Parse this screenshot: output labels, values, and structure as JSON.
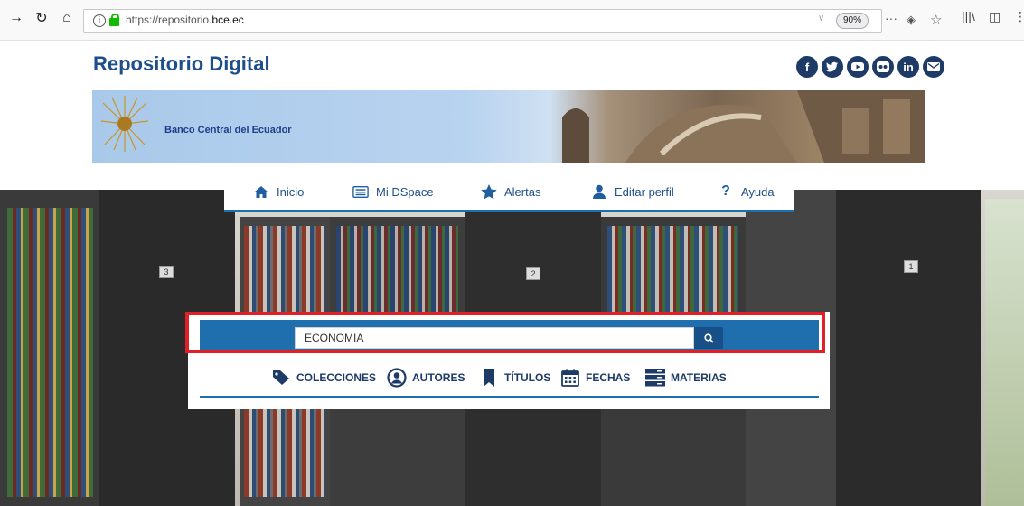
{
  "browser": {
    "url_prefix": "https://repositorio.",
    "url_domain": "bce.ec",
    "zoom": "90%"
  },
  "header": {
    "site_title": "Repositorio Digital",
    "banner_text": "Banco Central del Ecuador",
    "social": [
      "f",
      "t",
      "yt",
      "fk",
      "in",
      "mail"
    ]
  },
  "menu": {
    "items": [
      {
        "label": "Inicio",
        "icon": "home-icon"
      },
      {
        "label": "Mi DSpace",
        "icon": "list-icon"
      },
      {
        "label": "Alertas",
        "icon": "star-icon"
      },
      {
        "label": "Editar perfil",
        "icon": "user-icon"
      },
      {
        "label": "Ayuda",
        "icon": "question-icon"
      }
    ]
  },
  "search": {
    "value": "ECONOMIA"
  },
  "browse": {
    "items": [
      {
        "label": "COLECCIONES",
        "icon": "tag-icon"
      },
      {
        "label": "AUTORES",
        "icon": "user-circle-icon"
      },
      {
        "label": "TÍTULOS",
        "icon": "bookmark-icon"
      },
      {
        "label": "FECHAS",
        "icon": "calendar-icon"
      },
      {
        "label": "MATERIAS",
        "icon": "server-icon"
      }
    ]
  },
  "shelves": {
    "numbers": [
      "3",
      "2",
      "1"
    ]
  },
  "colors": {
    "accent": "#1f6fae",
    "title": "#1e4f8a",
    "highlight": "#e31e24"
  }
}
